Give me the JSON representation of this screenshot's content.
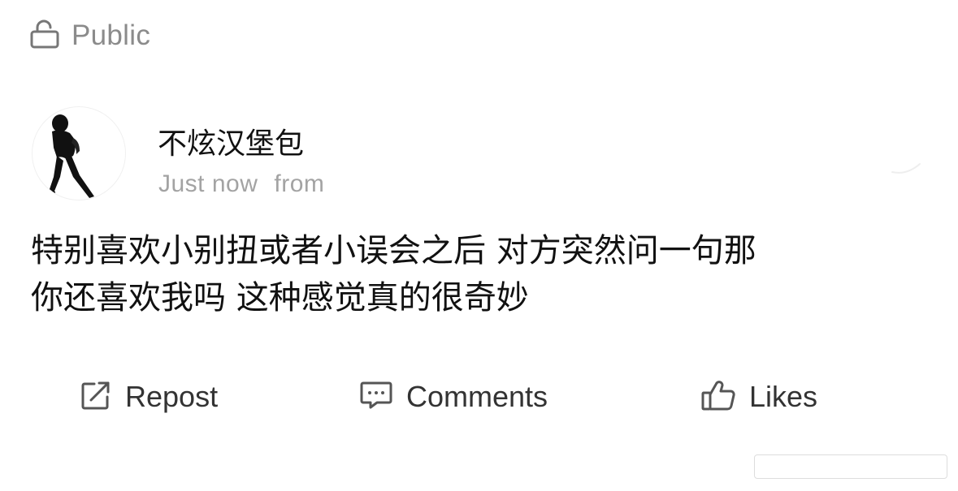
{
  "visibility": {
    "label": "Public",
    "icon": "unlock-icon"
  },
  "author": {
    "name": "不炫汉堡包",
    "timestamp": "Just now",
    "source_prefix": "from"
  },
  "post": {
    "line1": "特别喜欢小别扭或者小误会之后 对方突然问一句那",
    "line2": "你还喜欢我吗 这种感觉真的很奇妙"
  },
  "actions": {
    "repost": {
      "label": "Repost",
      "icon": "repost-icon"
    },
    "comments": {
      "label": "Comments",
      "icon": "comment-icon"
    },
    "likes": {
      "label": "Likes",
      "icon": "thumbs-up-icon"
    }
  },
  "colors": {
    "text_primary": "#111111",
    "text_secondary": "#a3a3a3",
    "visibility_text": "#8b8b8b",
    "action_text": "#333333"
  }
}
